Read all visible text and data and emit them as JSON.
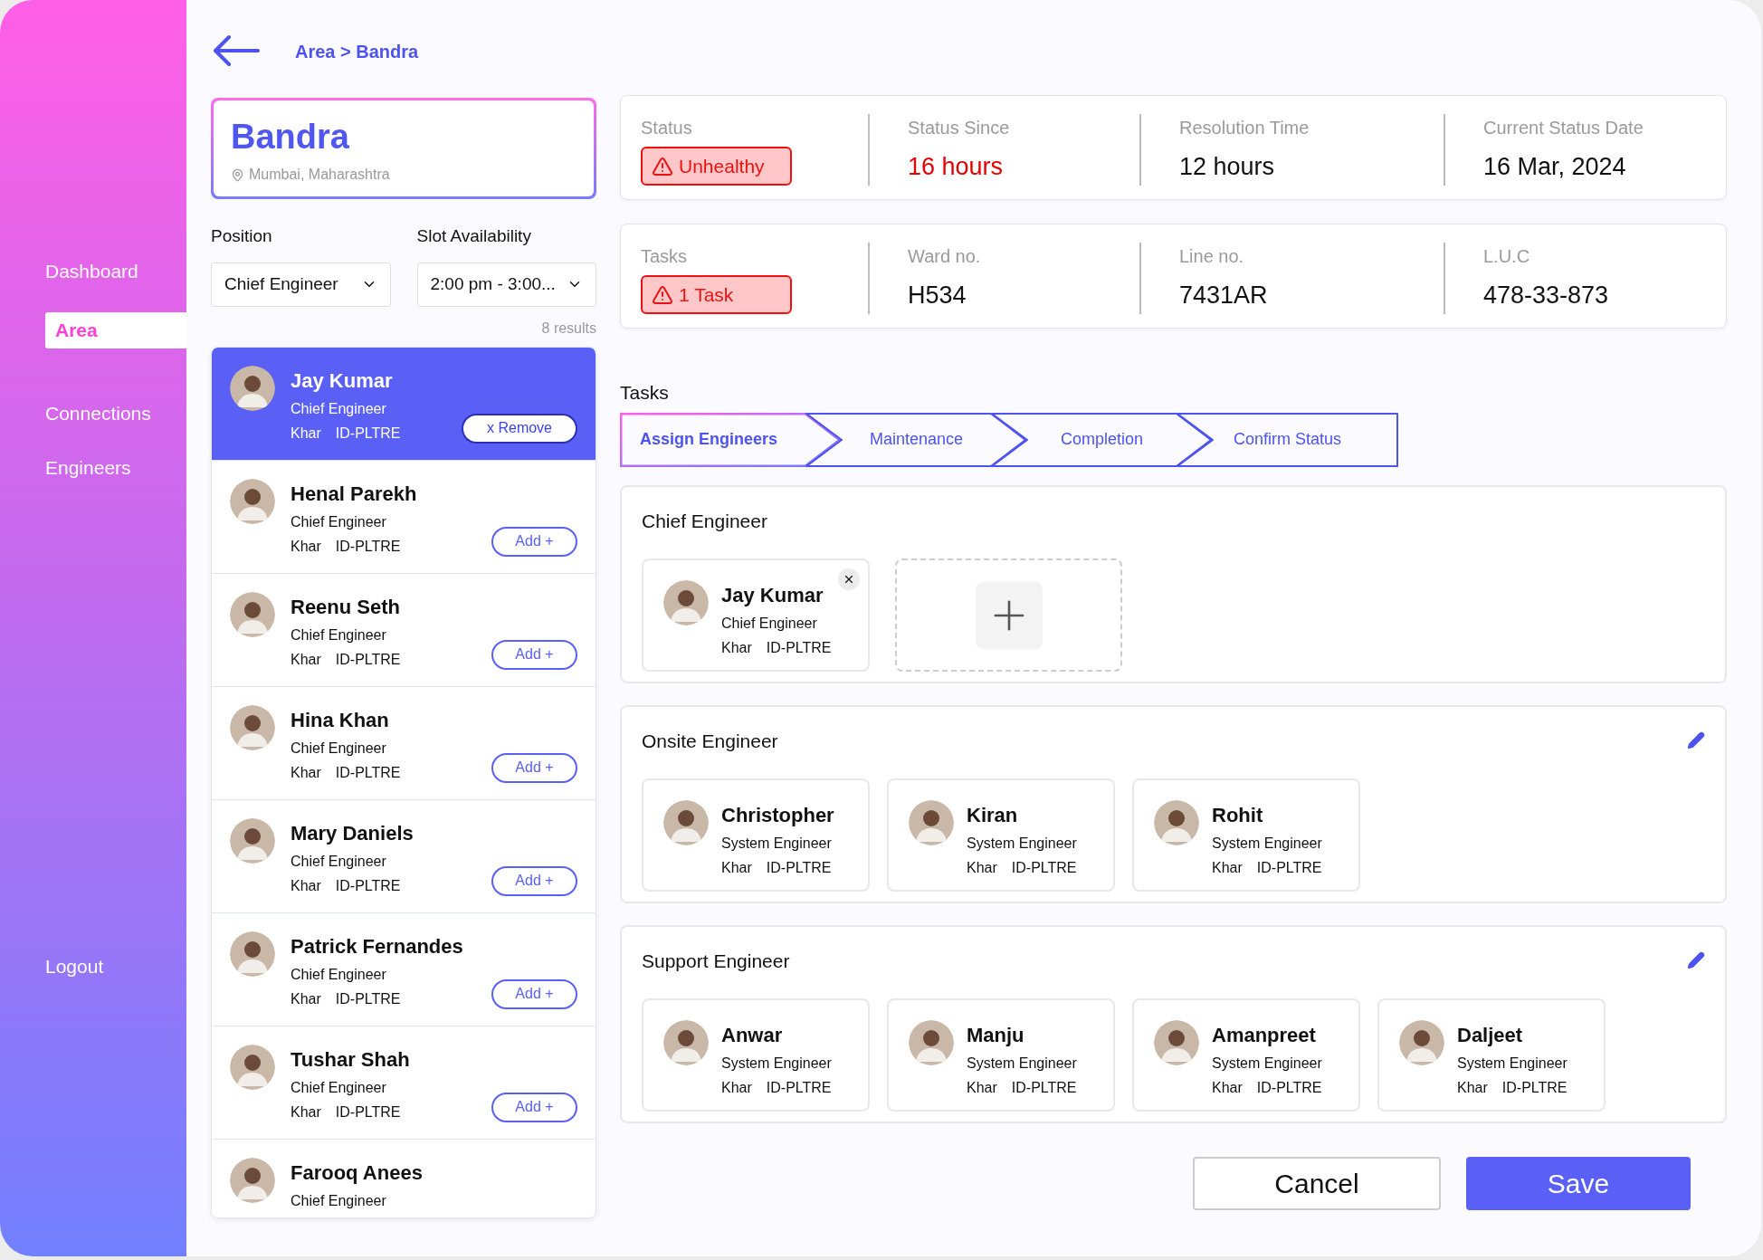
{
  "sidebar": {
    "items": [
      {
        "label": "Dashboard",
        "selected": false
      },
      {
        "label": "Area",
        "selected": true
      },
      {
        "label": "Connections",
        "selected": false
      },
      {
        "label": "Engineers",
        "selected": false
      }
    ],
    "logout": "Logout"
  },
  "breadcrumb": "Area > Bandra",
  "area": {
    "name": "Bandra",
    "location": "Mumbai, Maharashtra"
  },
  "filters": [
    {
      "label": "Position",
      "value": "Chief Engineer"
    },
    {
      "label": "Slot Availability",
      "value": "2:00 pm - 3:00..."
    }
  ],
  "results": "8 results",
  "engineers": [
    {
      "name": "Jay Kumar",
      "role": "Chief Engineer",
      "location": "Khar",
      "id": "ID-PLTRE",
      "selected": true,
      "action": "x Remove"
    },
    {
      "name": "Henal Parekh",
      "role": "Chief Engineer",
      "location": "Khar",
      "id": "ID-PLTRE",
      "selected": false,
      "action": "Add +"
    },
    {
      "name": "Reenu Seth",
      "role": "Chief Engineer",
      "location": "Khar",
      "id": "ID-PLTRE",
      "selected": false,
      "action": "Add +"
    },
    {
      "name": "Hina Khan",
      "role": "Chief Engineer",
      "location": "Khar",
      "id": "ID-PLTRE",
      "selected": false,
      "action": "Add +"
    },
    {
      "name": "Mary Daniels",
      "role": "Chief Engineer",
      "location": "Khar",
      "id": "ID-PLTRE",
      "selected": false,
      "action": "Add +"
    },
    {
      "name": "Patrick Fernandes",
      "role": "Chief Engineer",
      "location": "Khar",
      "id": "ID-PLTRE",
      "selected": false,
      "action": "Add +"
    },
    {
      "name": "Tushar Shah",
      "role": "Chief Engineer",
      "location": "Khar",
      "id": "ID-PLTRE",
      "selected": false,
      "action": "Add +"
    },
    {
      "name": "Farooq Anees",
      "role": "Chief Engineer",
      "selected": false
    }
  ],
  "info_rows": [
    [
      {
        "label": "Status",
        "value": "Unhealthy",
        "kind": "alert"
      },
      {
        "label": "Status Since",
        "value": "16 hours",
        "kind": "warning"
      },
      {
        "label": "Resolution Time",
        "value": "12 hours",
        "kind": "plain"
      },
      {
        "label": "Current Status Date",
        "value": "16 Mar, 2024",
        "kind": "plain"
      }
    ],
    [
      {
        "label": "Tasks",
        "value": "1 Task",
        "kind": "alert"
      },
      {
        "label": "Ward no.",
        "value": "H534",
        "kind": "plain"
      },
      {
        "label": "Line no.",
        "value": "7431AR",
        "kind": "plain"
      },
      {
        "label": "L.U.C",
        "value": "478-33-873",
        "kind": "plain"
      }
    ]
  ],
  "tasks": {
    "title": "Tasks",
    "steps": [
      {
        "label": "Assign Engineers",
        "selected": true
      },
      {
        "label": "Maintenance",
        "selected": false
      },
      {
        "label": "Completion",
        "selected": false
      },
      {
        "label": "Confirm Status",
        "selected": false
      }
    ]
  },
  "sections": [
    {
      "title": "Chief Engineer",
      "editable": false,
      "add_slot": true,
      "members": [
        {
          "name": "Jay Kumar",
          "role": "Chief Engineer",
          "location": "Khar",
          "id": "ID-PLTRE",
          "removable": true
        }
      ]
    },
    {
      "title": "Onsite Engineer",
      "editable": true,
      "add_slot": false,
      "members": [
        {
          "name": "Christopher",
          "role": "System Engineer",
          "location": "Khar",
          "id": "ID-PLTRE",
          "removable": false
        },
        {
          "name": "Kiran",
          "role": "System Engineer",
          "location": "Khar",
          "id": "ID-PLTRE",
          "removable": false
        },
        {
          "name": "Rohit",
          "role": "System Engineer",
          "location": "Khar",
          "id": "ID-PLTRE",
          "removable": false
        }
      ]
    },
    {
      "title": "Support Engineer",
      "editable": true,
      "add_slot": false,
      "members": [
        {
          "name": "Anwar",
          "role": "System Engineer",
          "location": "Khar",
          "id": "ID-PLTRE",
          "removable": false
        },
        {
          "name": "Manju",
          "role": "System Engineer",
          "location": "Khar",
          "id": "ID-PLTRE",
          "removable": false
        },
        {
          "name": "Amanpreet",
          "role": "System Engineer",
          "location": "Khar",
          "id": "ID-PLTRE",
          "removable": false
        },
        {
          "name": "Daljeet",
          "role": "System Engineer",
          "location": "Khar",
          "id": "ID-PLTRE",
          "removable": false
        }
      ]
    }
  ],
  "buttons": [
    {
      "label": "Cancel",
      "kind": "secondary"
    },
    {
      "label": "Save",
      "kind": "primary"
    }
  ]
}
